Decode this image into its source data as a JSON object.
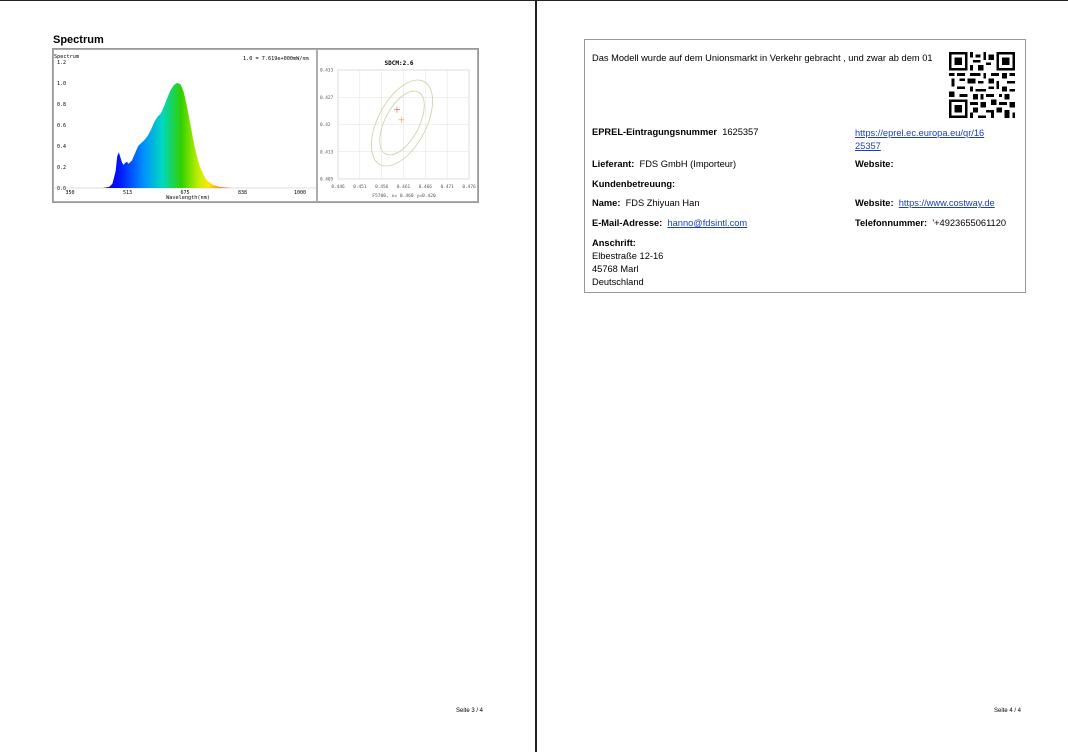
{
  "left_page": {
    "section_title": "Spectrum",
    "footer": "Seite 3 / 4"
  },
  "spectrum_chart": {
    "inner_title": "Spectrum",
    "scale_note": "1.0 = 7.619e+000mW/nm",
    "xlabel": "Wavelength(nm)",
    "ytick_labels": [
      "0.0",
      "0.2",
      "0.4",
      "0.6",
      "0.8",
      "1.0",
      "1.2"
    ],
    "xtick_labels": [
      "350",
      "513",
      "675",
      "838",
      "1000"
    ]
  },
  "sdcm_chart": {
    "title": "SDCM:2.6",
    "ytick_labels": [
      "0.405",
      "0.413",
      "0.42",
      "0.427",
      "0.433"
    ],
    "xtick_labels": [
      "0.446",
      "0.451",
      "0.456",
      "0.461",
      "0.466",
      "0.471",
      "0.476"
    ],
    "footnote": "F5700, x= 0.460 y=0.420"
  },
  "chart_data": [
    {
      "type": "area",
      "title": "Spectrum",
      "xlabel": "Wavelength(nm)",
      "ylabel": "",
      "xlim": [
        350,
        1000
      ],
      "ylim": [
        0,
        1.2
      ],
      "grid": false,
      "series": [
        {
          "x": [
            380,
            400,
            410,
            420,
            425,
            430,
            440,
            445,
            450,
            455,
            460,
            470,
            480,
            490,
            500,
            510,
            520,
            530,
            540,
            550,
            560,
            570,
            580,
            590,
            600,
            610,
            620,
            625,
            630,
            635,
            640,
            650,
            660,
            670,
            680,
            690,
            700,
            720,
            740,
            760,
            780,
            800
          ],
          "values": [
            0.0,
            0.01,
            0.04,
            0.16,
            0.3,
            0.34,
            0.24,
            0.22,
            0.24,
            0.25,
            0.23,
            0.26,
            0.33,
            0.4,
            0.43,
            0.46,
            0.5,
            0.56,
            0.63,
            0.68,
            0.71,
            0.78,
            0.86,
            0.93,
            0.98,
            1.0,
            0.99,
            0.96,
            0.92,
            0.86,
            0.79,
            0.63,
            0.46,
            0.32,
            0.21,
            0.14,
            0.08,
            0.03,
            0.01,
            0.005,
            0.0,
            0.0
          ]
        }
      ]
    },
    {
      "type": "scatter",
      "title": "SDCM:2.6",
      "xlabel": "",
      "ylabel": "",
      "xlim": [
        0.446,
        0.476
      ],
      "ylim": [
        0.405,
        0.433
      ],
      "grid": true,
      "series": [
        {
          "x": [
            0.4595,
            0.4605
          ],
          "values": [
            0.4228,
            0.4202
          ]
        }
      ]
    }
  ],
  "right_page": {
    "intro_text": "Das Modell wurde auf dem Unionsmarkt in Verkehr gebracht , und zwar ab dem 01",
    "eprel_label": "EPREL-Eintragungsnummer",
    "eprel_value": "1625357",
    "eprel_link_line1": "https://eprel.ec.europa.eu/qr/16",
    "eprel_link_line2": "25357",
    "supplier_label": "Lieferant:",
    "supplier_value": "FDS GmbH (Importeur)",
    "website_label_1": "Website:",
    "customer_service_label": "Kundenbetreuung:",
    "name_label": "Name:",
    "name_value": "FDS Zhiyuan Han",
    "website_label_2": "Website:",
    "website_link": "https://www.costway.de",
    "email_label": "E-Mail-Adresse:",
    "email_link": "hanno@fdsintl.com",
    "phone_label": "Telefonnummer:",
    "phone_value": "'+4923655061120",
    "address_label": "Anschrift:",
    "address_lines": [
      "Elbestraße 12-16",
      "45768 Marl",
      "Deutschland"
    ],
    "footer": "Seite 4 / 4"
  }
}
